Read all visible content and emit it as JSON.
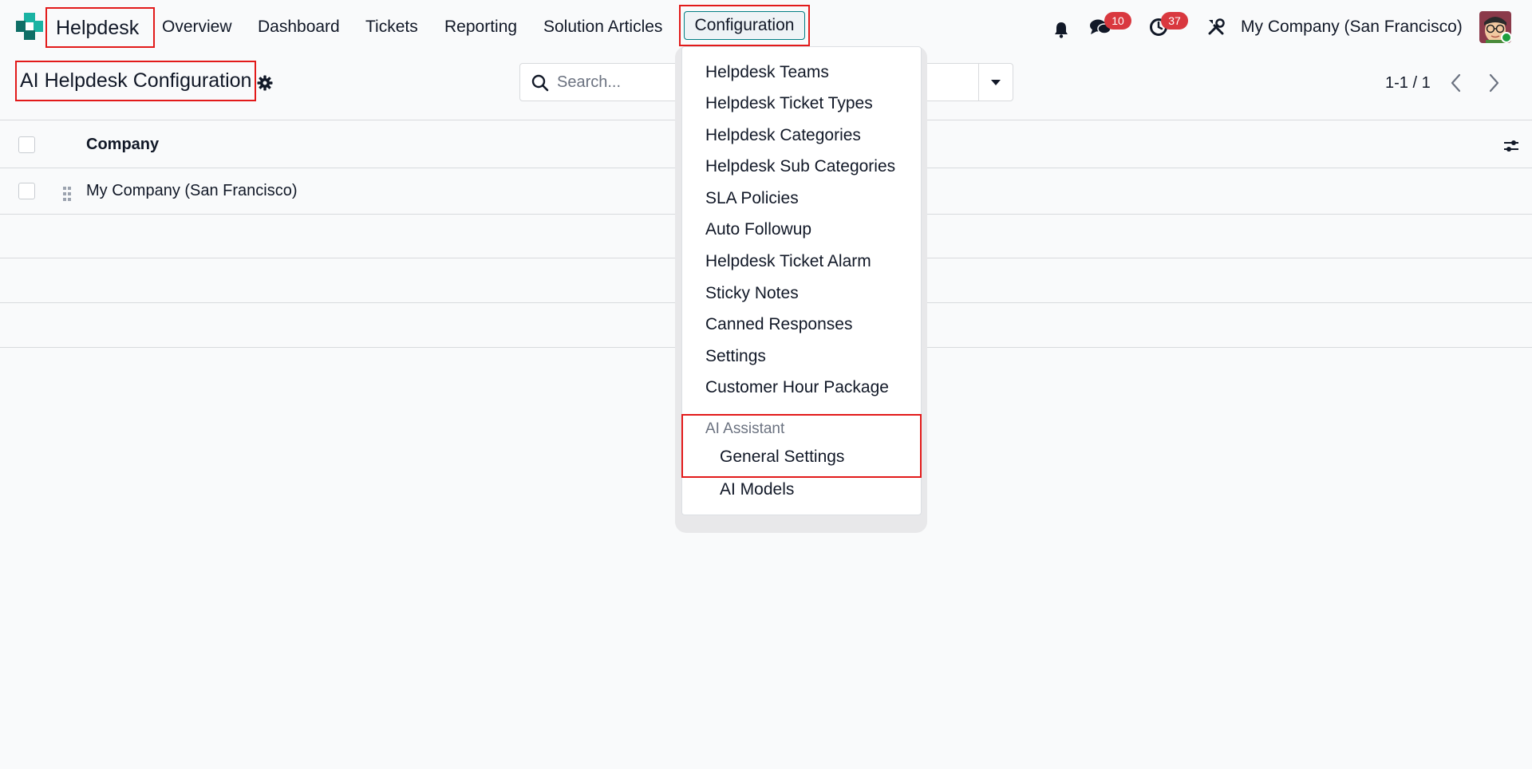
{
  "nav": {
    "app_name": "Helpdesk",
    "menus": [
      "Overview",
      "Dashboard",
      "Tickets",
      "Reporting",
      "Solution Articles",
      "Configuration"
    ],
    "active_menu": "Configuration",
    "messages_count": "10",
    "activities_count": "37",
    "company": "My Company (San Francisco)"
  },
  "control_panel": {
    "title": "AI Helpdesk Configuration",
    "search_placeholder": "Search...",
    "pager": "1-1 / 1"
  },
  "list": {
    "columns": [
      "Company"
    ],
    "rows": [
      {
        "company": "My Company (San Francisco)"
      }
    ]
  },
  "dropdown": {
    "items": [
      "Helpdesk Teams",
      "Helpdesk Ticket Types",
      "Helpdesk Categories",
      "Helpdesk Sub Categories",
      "SLA Policies",
      "Auto Followup",
      "Helpdesk Ticket Alarm",
      "Sticky Notes",
      "Canned Responses",
      "Settings",
      "Customer Hour Package"
    ],
    "section_title": "AI Assistant",
    "section_items": [
      "General Settings",
      "AI Models"
    ]
  },
  "colors": {
    "accent": "#017e84",
    "badge": "#d9383f",
    "highlight_box": "#e21a1a",
    "logo_teal": "#1ab3a3",
    "logo_dark": "#0f6e66"
  },
  "icons": [
    "helpdesk-logo-icon",
    "bell-icon",
    "chat-icon",
    "clock-icon",
    "tools-icon",
    "gear-icon",
    "search-icon",
    "caret-down-icon",
    "chevron-left-icon",
    "chevron-right-icon",
    "sliders-icon",
    "drag-handle-icon"
  ]
}
